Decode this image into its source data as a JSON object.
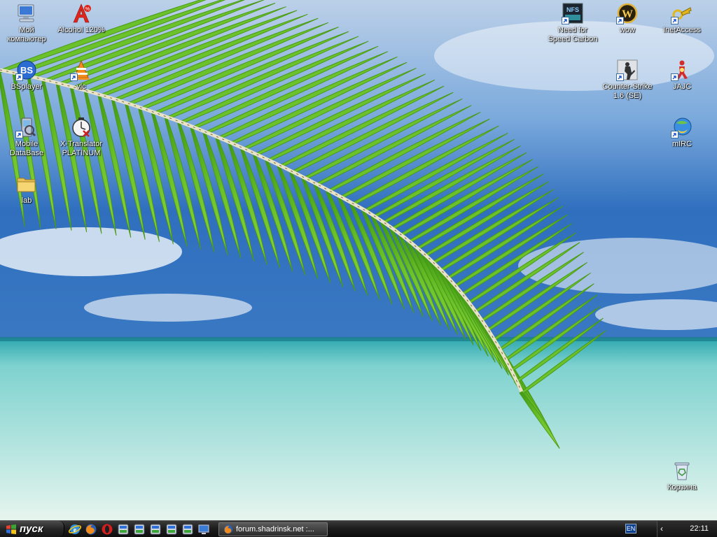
{
  "desktop": {
    "icons": [
      {
        "label": "Мой\nкомпьютер",
        "icon": "my-computer-icon",
        "shortcut": false
      },
      {
        "label": "Alcohol 120%",
        "icon": "alcohol-icon",
        "shortcut": false
      },
      {
        "label": "BSplayer",
        "icon": "bsplayer-icon",
        "shortcut": true
      },
      {
        "label": "vlc",
        "icon": "vlc-icon",
        "shortcut": true
      },
      {
        "label": "Mobile\nDataBase",
        "icon": "mobile-database-icon",
        "shortcut": true
      },
      {
        "label": "X-Translator\nPLATINUM",
        "icon": "x-translator-icon",
        "shortcut": false
      },
      {
        "label": "lab",
        "icon": "folder-icon",
        "shortcut": false
      },
      {
        "label": "Need for\nSpeed Carbon",
        "icon": "nfs-carbon-icon",
        "shortcut": true
      },
      {
        "label": "wow",
        "icon": "wow-icon",
        "shortcut": true
      },
      {
        "label": "InetAccess",
        "icon": "inetaccess-icon",
        "shortcut": true
      },
      {
        "label": "Counter-Strike\n1.6 (SE)",
        "icon": "counter-strike-icon",
        "shortcut": true
      },
      {
        "label": "JAJC",
        "icon": "jajc-icon",
        "shortcut": true
      },
      {
        "label": "mIRC",
        "icon": "mirc-icon",
        "shortcut": true
      },
      {
        "label": "Корзина",
        "icon": "recycle-bin-icon",
        "shortcut": false
      }
    ]
  },
  "taskbar": {
    "start_label": "пуск",
    "quick_launch": [
      "ie-icon",
      "firefox-icon",
      "opera-icon",
      "app-icon",
      "app-icon",
      "app-icon",
      "app-icon",
      "app-icon",
      "show-desktop-icon"
    ],
    "task": {
      "label": "forum.shadrinsk.net :...",
      "icon": "firefox-icon"
    },
    "language": "EN",
    "clock": "22:11"
  },
  "colors": {
    "sky": "#4a8fd6",
    "sea": "#8fd8d0",
    "palm": "#5cb321",
    "taskbar": "#1e1e1e"
  }
}
